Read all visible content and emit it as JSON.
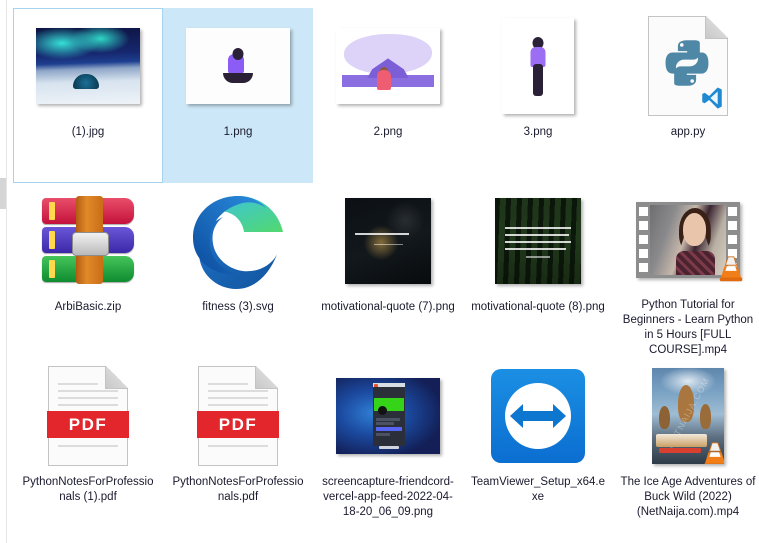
{
  "view": {
    "name": "file-explorer-grid",
    "background": "#ffffff",
    "selection_fill_color": "#cce7f7",
    "selection_outline_color": "#a6d4ef",
    "label_color": "#1a1a2e",
    "columns": 5,
    "rows": 3
  },
  "files": [
    {
      "name": "(1).jpg",
      "icon": "photo-aurora-thumbnail",
      "kind": "image",
      "state": "focused"
    },
    {
      "name": "1.png",
      "icon": "photo-yoga-illustration-thumbnail",
      "kind": "image",
      "state": "selected"
    },
    {
      "name": "2.png",
      "icon": "photo-temple-meditation-illustration-thumbnail",
      "kind": "image",
      "state": "normal"
    },
    {
      "name": "3.png",
      "icon": "photo-tree-pose-illustration-thumbnail",
      "kind": "image",
      "state": "normal"
    },
    {
      "name": "app.py",
      "icon": "python-file-icon",
      "kind": "python-source",
      "state": "normal"
    },
    {
      "name": "ArbiBasic.zip",
      "icon": "winrar-archive-icon",
      "kind": "archive",
      "state": "normal"
    },
    {
      "name": "fitness (3).svg",
      "icon": "microsoft-edge-icon",
      "kind": "svg-image",
      "state": "normal"
    },
    {
      "name": "motivational-quote (7).png",
      "icon": "photo-dark-lotus-quote-thumbnail",
      "kind": "image",
      "state": "normal"
    },
    {
      "name": "motivational-quote (8).png",
      "icon": "photo-dark-forest-quote-thumbnail",
      "kind": "image",
      "state": "normal"
    },
    {
      "name": "Python Tutorial for Beginners - Learn Python in 5 Hours [FULL COURSE].mp4",
      "icon": "film-strip-video-thumbnail",
      "overlay_icon": "vlc-cone-icon",
      "kind": "video",
      "state": "normal"
    },
    {
      "name": "PythonNotesForProfessionals (1).pdf",
      "icon": "pdf-file-icon",
      "badge_text": "PDF",
      "kind": "pdf",
      "state": "normal"
    },
    {
      "name": "PythonNotesForProfessionals.pdf",
      "icon": "pdf-file-icon",
      "badge_text": "PDF",
      "kind": "pdf",
      "state": "normal"
    },
    {
      "name": "screencapture-friendcord-vercel-app-feed-2022-04-18-20_06_09.png",
      "icon": "photo-screencapture-thumbnail",
      "kind": "image",
      "state": "normal"
    },
    {
      "name": "TeamViewer_Setup_x64.exe",
      "icon": "teamviewer-icon",
      "kind": "executable",
      "state": "normal"
    },
    {
      "name": "The Ice Age Adventures of Buck Wild (2022) (NetNaija.com).mp4",
      "icon": "movie-poster-thumbnail",
      "overlay_icon": "vlc-cone-icon",
      "poster_watermark": "NETNAIJA.COM",
      "kind": "video",
      "state": "normal"
    }
  ]
}
